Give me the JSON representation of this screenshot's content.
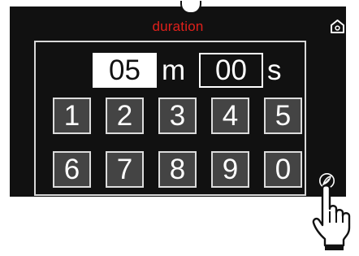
{
  "title": "duration",
  "time": {
    "minutes_value": "05",
    "minutes_unit": "m",
    "seconds_value": "00",
    "seconds_unit": "s"
  },
  "keypad": {
    "keys": [
      "1",
      "2",
      "3",
      "4",
      "5",
      "6",
      "7",
      "8",
      "9",
      "0"
    ]
  },
  "icons": {
    "home": "home-icon",
    "eco": "leaf-icon",
    "pointer": "hand-pointer-icon"
  },
  "colors": {
    "screen_background": "#111111",
    "title": "#e0201b",
    "key_background": "#444444",
    "border": "#dcdcdc",
    "highlight": "#ffffff"
  }
}
